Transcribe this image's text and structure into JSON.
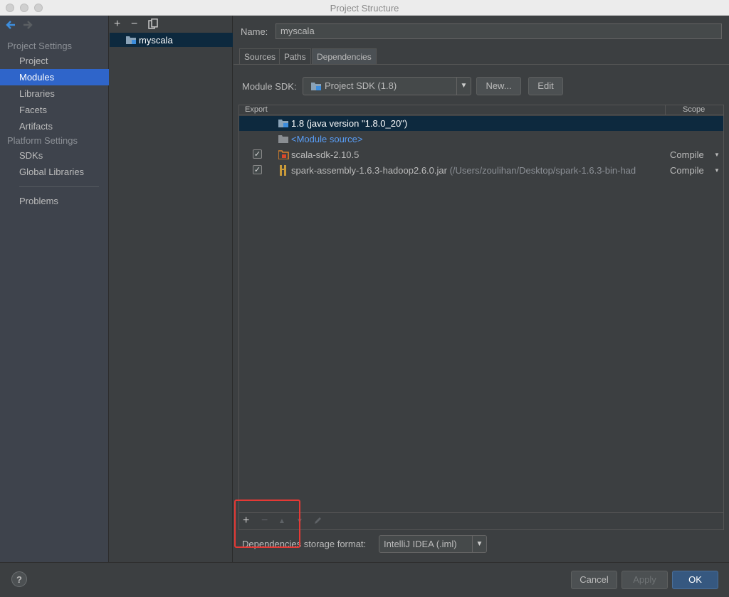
{
  "window": {
    "title": "Project Structure"
  },
  "sidebar": {
    "back_icon": "arrow-left-icon",
    "forward_icon": "arrow-right-icon",
    "project_settings_header": "Project Settings",
    "project_items": [
      "Project",
      "Modules",
      "Libraries",
      "Facets",
      "Artifacts"
    ],
    "platform_settings_header": "Platform Settings",
    "platform_items": [
      "SDKs",
      "Global Libraries"
    ],
    "problems": "Problems",
    "selected": "Modules"
  },
  "module_list": {
    "add_glyph": "+",
    "remove_glyph": "−",
    "copy_icon": "copy-icon",
    "items": [
      "myscala"
    ]
  },
  "details": {
    "name_label": "Name:",
    "name_value": "myscala",
    "tabs": [
      "Sources",
      "Paths",
      "Dependencies"
    ],
    "selected_tab": "Dependencies",
    "sdk_label": "Module SDK:",
    "sdk_value": "Project SDK (1.8)",
    "new_button": "New...",
    "edit_button": "Edit",
    "table": {
      "col_export": "Export",
      "col_scope": "Scope",
      "rows": [
        {
          "label": "1.8 (java version \"1.8.0_20\")",
          "path": "",
          "scope": "",
          "checked": false
        },
        {
          "label": "<Module source>",
          "path": "",
          "scope": "",
          "checked": false
        },
        {
          "label": "scala-sdk-2.10.5",
          "path": "",
          "scope": "Compile",
          "checked": true
        },
        {
          "label": "spark-assembly-1.6.3-hadoop2.6.0.jar",
          "path": "(/Users/zoulihan/Desktop/spark-1.6.3-bin-had",
          "scope": "Compile",
          "checked": true
        }
      ]
    },
    "toolbar": {
      "add": "+",
      "remove": "−",
      "up": "▲",
      "down": "▼",
      "edit_icon": "pencil-icon"
    },
    "storage_label": "Dependencies storage format:",
    "storage_value": "IntelliJ IDEA (.iml)"
  },
  "footer": {
    "help": "?",
    "cancel": "Cancel",
    "apply": "Apply",
    "ok": "OK"
  },
  "colors": {
    "accent": "#2f65ca",
    "selection_dark": "#0d293e",
    "link": "#589df6",
    "highlight_box": "#e53935"
  }
}
